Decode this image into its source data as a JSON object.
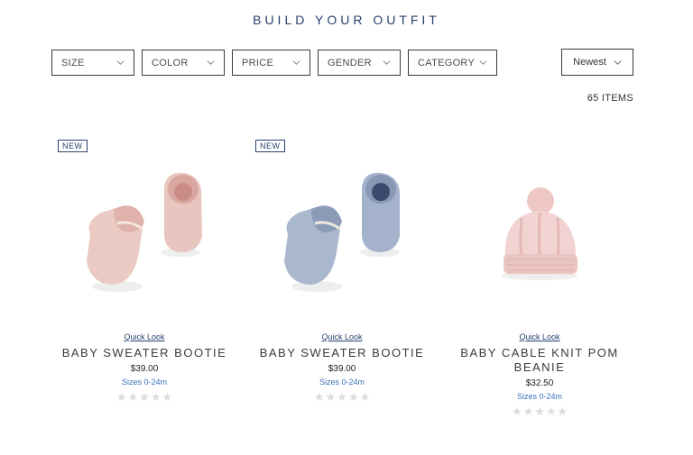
{
  "header": {
    "title": "BUILD YOUR OUTFIT"
  },
  "filters": [
    {
      "label": "SIZE"
    },
    {
      "label": "COLOR"
    },
    {
      "label": "PRICE"
    },
    {
      "label": "GENDER"
    },
    {
      "label": "CATEGORY"
    }
  ],
  "sort": {
    "selected": "Newest"
  },
  "results": {
    "count_label": "65 ITEMS"
  },
  "products": [
    {
      "badge": "NEW",
      "quick_look": "Quick Look",
      "name": "BABY SWEATER BOOTIE",
      "price": "$39.00",
      "sizes": "Sizes 0-24m",
      "rating": 0,
      "image_icon": "pink-booties-image",
      "color": "#e9c9c4"
    },
    {
      "badge": "NEW",
      "quick_look": "Quick Look",
      "name": "BABY SWEATER BOOTIE",
      "price": "$39.00",
      "sizes": "Sizes 0-24m",
      "rating": 0,
      "image_icon": "blue-booties-image",
      "color": "#a9b6cc"
    },
    {
      "quick_look": "Quick Look",
      "name": "BABY CABLE KNIT POM BEANIE",
      "price": "$32.50",
      "sizes": "Sizes 0-24m",
      "rating": 0,
      "image_icon": "pink-beanie-image",
      "color": "#f0d2d0"
    }
  ],
  "colors": {
    "title": "#27416d",
    "link": "#3b73b9",
    "star_empty": "#dcdcdc"
  }
}
